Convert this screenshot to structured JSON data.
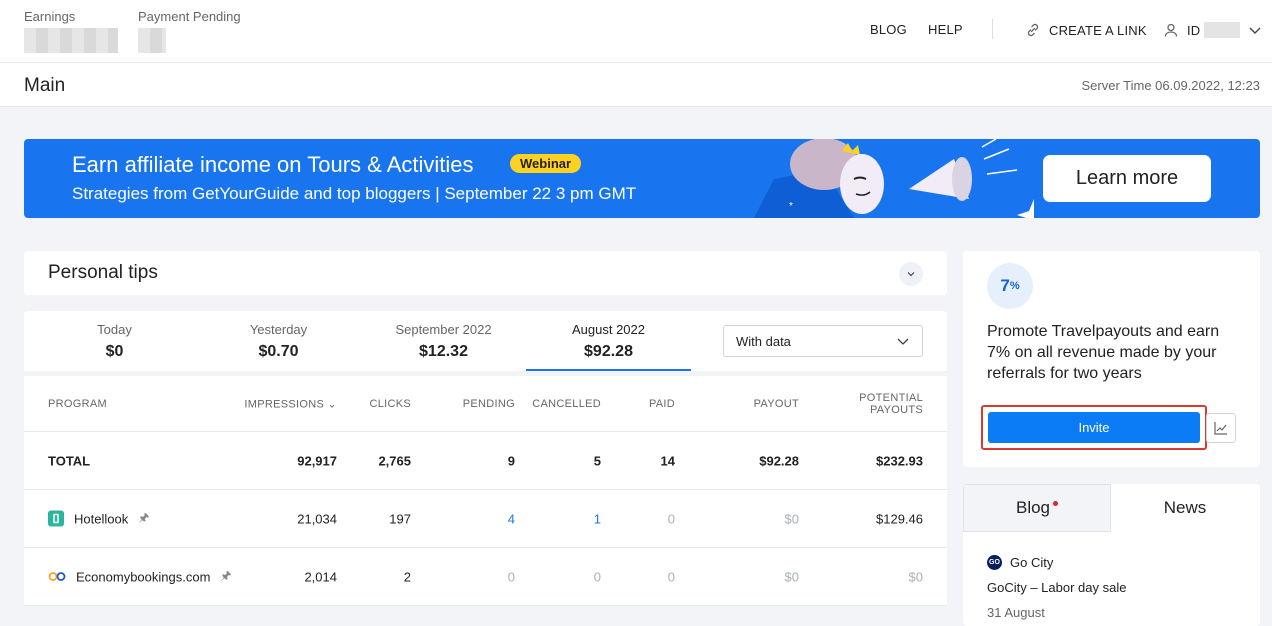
{
  "header": {
    "earnings_label": "Earnings",
    "pending_label": "Payment Pending",
    "nav_blog": "BLOG",
    "nav_help": "HELP",
    "create_link": "CREATE A LINK",
    "user_id_label": "ID"
  },
  "subheader": {
    "title": "Main",
    "server_time": "Server Time 06.09.2022, 12:23"
  },
  "banner": {
    "title": "Earn affiliate income on Tours & Activities",
    "badge": "Webinar",
    "subtitle": "Strategies from GetYourGuide and top bloggers | September 22 3 pm GMT",
    "button": "Learn more",
    "bg_color": "#1975ef"
  },
  "tips": {
    "title": "Personal tips"
  },
  "periods": [
    {
      "label": "Today",
      "value": "$0"
    },
    {
      "label": "Yesterday",
      "value": "$0.70"
    },
    {
      "label": "September 2022",
      "value": "$12.32"
    },
    {
      "label": "August 2022",
      "value": "$92.28"
    }
  ],
  "filter": {
    "selected": "With data"
  },
  "table": {
    "headers": [
      "PROGRAM",
      "IMPRESSIONS",
      "CLICKS",
      "PENDING",
      "CANCELLED",
      "PAID",
      "PAYOUT",
      "POTENTIAL",
      "PAYOUTS"
    ],
    "total": [
      "TOTAL",
      "92,917",
      "2,765",
      "9",
      "5",
      "14",
      "$92.28",
      "$232.93"
    ],
    "rows": [
      [
        "Hotellook",
        "21,034",
        "197",
        "4",
        "1",
        "0",
        "$0",
        "$129.46"
      ],
      [
        "Economybookings.com",
        "2,014",
        "2",
        "0",
        "0",
        "0",
        "$0",
        "$0"
      ]
    ]
  },
  "promo": {
    "percent": "7",
    "percent_sign": "%",
    "text": "Promote Travelpayouts and earn 7% on all revenue made by your referrals for two years",
    "invite": "Invite"
  },
  "news": {
    "tab_blog": "Blog",
    "tab_news": "News",
    "source": "Go City",
    "source_logo": "GO",
    "item_title": "GoCity – Labor day sale",
    "item_date": "31 August"
  }
}
